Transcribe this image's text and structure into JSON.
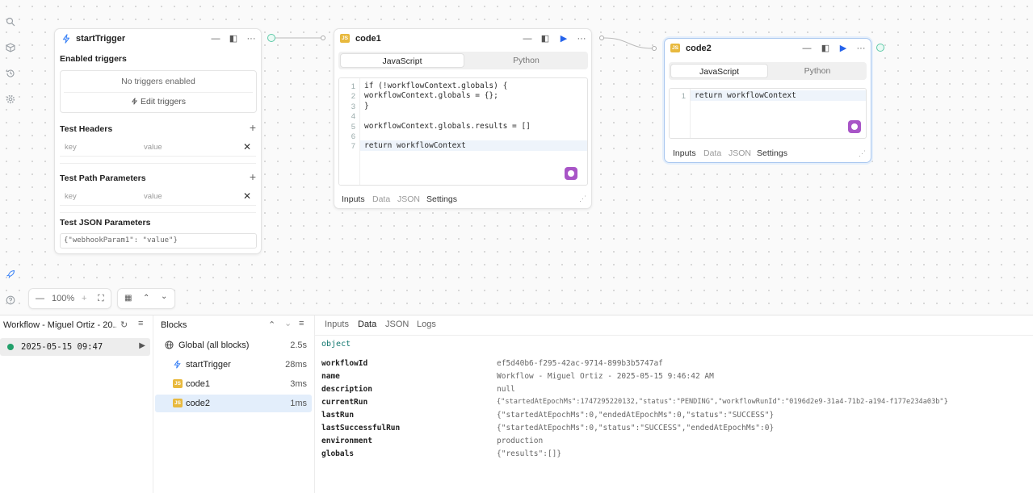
{
  "rail_icons": [
    "search-icon",
    "cube-icon",
    "history-icon",
    "settings-icon",
    "rocket-icon",
    "help-icon"
  ],
  "trigger_node": {
    "title": "startTrigger",
    "enabled_triggers_label": "Enabled triggers",
    "no_triggers_text": "No triggers enabled",
    "edit_triggers_label": "Edit triggers",
    "test_headers_label": "Test Headers",
    "headers_key_placeholder": "key",
    "headers_value_placeholder": "value",
    "test_path_params_label": "Test Path Parameters",
    "path_key_placeholder": "key",
    "path_value_placeholder": "value",
    "test_json_params_label": "Test JSON Parameters",
    "json_params_value": "{\"webhookParam1\": \"value\"}"
  },
  "code1": {
    "badge": "JS",
    "title": "code1",
    "lang_js": "JavaScript",
    "lang_py": "Python",
    "line_numbers": [
      "1",
      "2",
      "3",
      "4",
      "5",
      "6",
      "7"
    ],
    "lines": [
      "if (!workflowContext.globals) {",
      "workflowContext.globals = {};",
      "}",
      "",
      "workflowContext.globals.results = []",
      "",
      "return workflowContext"
    ],
    "tabs": [
      "Inputs",
      "Data",
      "JSON",
      "Settings"
    ]
  },
  "code2": {
    "badge": "JS",
    "title": "code2",
    "lang_js": "JavaScript",
    "lang_py": "Python",
    "line_numbers": [
      "1"
    ],
    "lines": [
      "return workflowContext"
    ],
    "tabs": [
      "Inputs",
      "Data",
      "JSON",
      "Settings"
    ]
  },
  "zoom": {
    "level": "100%"
  },
  "runs": {
    "title": "Workflow - Miguel Ortiz - 20...",
    "items": [
      {
        "time": "2025-05-15 09:47",
        "status_color": "#22a06b"
      }
    ]
  },
  "blocks": {
    "title": "Blocks",
    "items": [
      {
        "label": "Global (all blocks)",
        "time": "2.5s",
        "icon": "globe-icon"
      },
      {
        "label": "startTrigger",
        "time": "28ms",
        "icon": "lightning-icon"
      },
      {
        "label": "code1",
        "time": "3ms",
        "icon": "js-icon"
      },
      {
        "label": "code2",
        "time": "1ms",
        "icon": "js-icon"
      }
    ]
  },
  "data_panel": {
    "tabs": [
      "Inputs",
      "Data",
      "JSON",
      "Logs"
    ],
    "active_tab": "Data",
    "type_label": "object",
    "rows": [
      {
        "key": "workflowId",
        "value": "ef5d40b6-f295-42ac-9714-899b3b5747af"
      },
      {
        "key": "name",
        "value": "Workflow - Miguel Ortiz - 2025-05-15 9:46:42 AM"
      },
      {
        "key": "description",
        "value": "null"
      },
      {
        "key": "currentRun",
        "value": "{\"startedAtEpochMs\":1747295220132,\"status\":\"PENDING\",\"workflowRunId\":\"0196d2e9-31a4-71b2-a194-f177e234a03b\"}"
      },
      {
        "key": "lastRun",
        "value": "{\"startedAtEpochMs\":0,\"endedAtEpochMs\":0,\"status\":\"SUCCESS\"}"
      },
      {
        "key": "lastSuccessfulRun",
        "value": "{\"startedAtEpochMs\":0,\"status\":\"SUCCESS\",\"endedAtEpochMs\":0}"
      },
      {
        "key": "environment",
        "value": "production"
      },
      {
        "key": "globals",
        "value": "{\"results\":[]}"
      }
    ]
  },
  "colors": {
    "accent": "#2563eb",
    "success": "#22a06b",
    "js_badge": "#e8b93e",
    "connector": "#5cc9a7",
    "assistant": "#a855c7"
  }
}
